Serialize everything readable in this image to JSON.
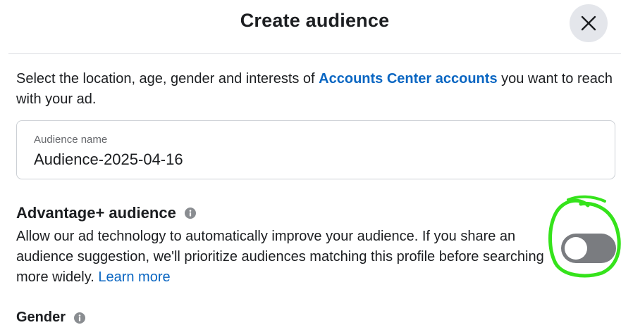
{
  "dialog": {
    "title": "Create audience",
    "close_icon": "close-icon"
  },
  "intro": {
    "text_before": "Select the location, age, gender and interests of ",
    "link_text": "Accounts Center accounts",
    "text_after": " you want to reach with your ad."
  },
  "audience_name": {
    "label": "Audience name",
    "value": "Audience-2025-04-16"
  },
  "advantage": {
    "title": "Advantage+ audience",
    "info_icon": "info-icon",
    "description": "Allow our ad technology to automatically improve your audience. If you share an audience suggestion, we'll prioritize audiences matching this profile before searching more widely.",
    "learn_more": "Learn more",
    "toggle_on": false
  },
  "gender": {
    "title": "Gender",
    "info_icon": "info-icon"
  },
  "colors": {
    "link": "#0a66c2",
    "toggle_off": "#7a7c80",
    "annotation": "#35e31b",
    "close_bg": "#e4e6eb"
  }
}
